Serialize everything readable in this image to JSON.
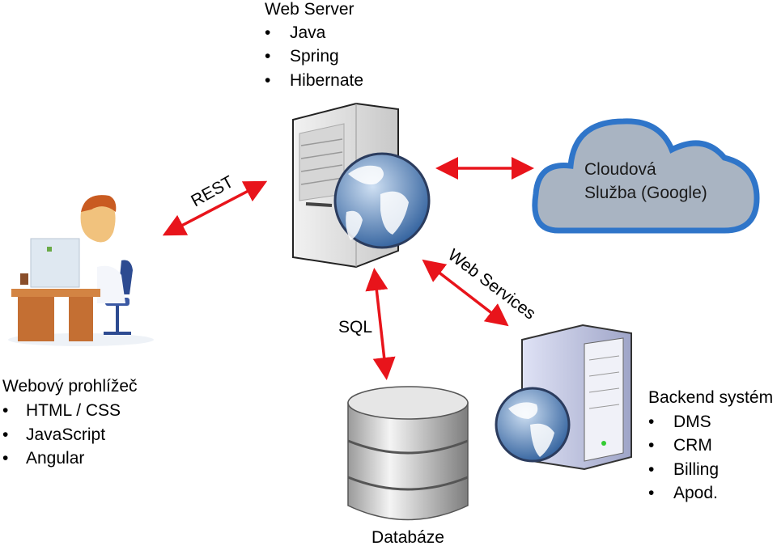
{
  "web_server": {
    "title": "Web Server",
    "items": [
      "Java",
      "Spring",
      "Hibernate"
    ]
  },
  "cloud": {
    "lines": [
      "Cloudová",
      "Služba (Google)"
    ]
  },
  "browser": {
    "title": "Webový prohlížeč",
    "items": [
      "HTML / CSS",
      "JavaScript",
      "Angular"
    ]
  },
  "backend": {
    "title": "Backend systém",
    "items": [
      "DMS",
      "CRM",
      "Billing",
      "Apod."
    ]
  },
  "database": {
    "label": "Databáze"
  },
  "connections": {
    "rest": "REST",
    "sql": "SQL",
    "web_services": "Web Services"
  },
  "bullet": "•",
  "colors": {
    "arrow": "#e8141b",
    "cloud_fill": "#a9b4c2",
    "cloud_stroke": "#2f75c9",
    "globe": "#3f6fa8"
  }
}
